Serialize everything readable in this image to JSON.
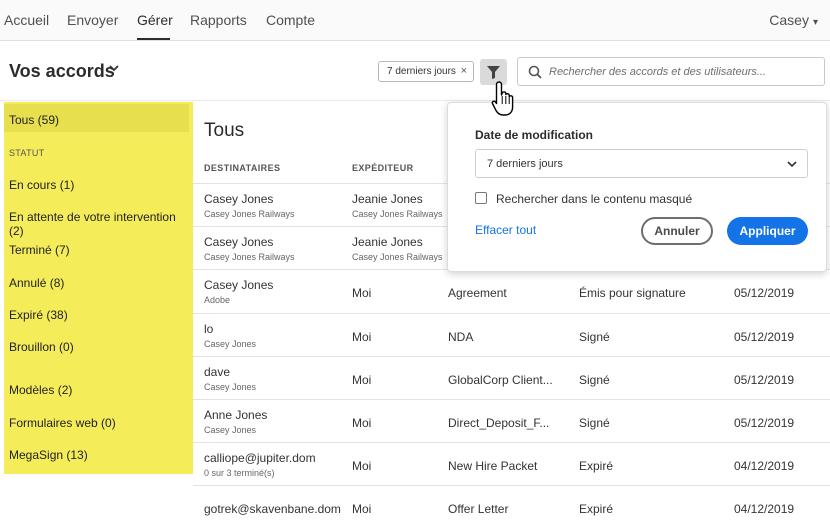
{
  "topnav": {
    "items": [
      {
        "label": "Accueil"
      },
      {
        "label": "Envoyer"
      },
      {
        "label": "Gérer"
      },
      {
        "label": "Rapports"
      },
      {
        "label": "Compte"
      }
    ],
    "user": "Casey"
  },
  "header": {
    "title": "Vos accords",
    "filter_chip": "7 derniers jours",
    "search_placeholder": "Rechercher des accords et des utilisateurs..."
  },
  "sidebar": {
    "all": "Tous (59)",
    "status_heading": "STATUT",
    "status_items": [
      "En cours (1)",
      "En attente de votre intervention (2)",
      "Terminé (7)",
      "Annulé (8)",
      "Expiré (38)",
      "Brouillon (0)"
    ],
    "other_items": [
      "Modèles (2)",
      "Formulaires web (0)",
      "MegaSign (13)"
    ]
  },
  "list": {
    "title": "Tous",
    "col_recipients": "DESTINATAIRES",
    "col_sender": "EXPÉDITEUR",
    "rows": [
      {
        "recipient": "Casey Jones",
        "recipient_sub": "Casey Jones Railways",
        "sender": "Jeanie Jones",
        "sender_sub": "Casey Jones Railways",
        "name": "",
        "status": "",
        "date": ""
      },
      {
        "recipient": "Casey Jones",
        "recipient_sub": "Casey Jones Railways",
        "sender": "Jeanie Jones",
        "sender_sub": "Casey Jones Railways",
        "name": "",
        "status": "",
        "date": ""
      },
      {
        "recipient": "Casey Jones",
        "recipient_sub": "Adobe",
        "sender": "Moi",
        "sender_sub": "",
        "name": "Agreement",
        "status": "Émis pour signature",
        "date": "05/12/2019"
      },
      {
        "recipient": "lo",
        "recipient_sub": "Casey Jones",
        "sender": "Moi",
        "sender_sub": "",
        "name": "NDA",
        "status": "Signé",
        "date": "05/12/2019"
      },
      {
        "recipient": "dave",
        "recipient_sub": "Casey Jones",
        "sender": "Moi",
        "sender_sub": "",
        "name": "GlobalCorp Client...",
        "status": "Signé",
        "date": "05/12/2019"
      },
      {
        "recipient": "Anne Jones",
        "recipient_sub": "Casey Jones",
        "sender": "Moi",
        "sender_sub": "",
        "name": "Direct_Deposit_F...",
        "status": "Signé",
        "date": "05/12/2019"
      },
      {
        "recipient": "calliope@jupiter.dom",
        "recipient_sub": "0 sur 3 terminé(s)",
        "sender": "Moi",
        "sender_sub": "",
        "name": "New Hire Packet",
        "status": "Expiré",
        "date": "04/12/2019"
      },
      {
        "recipient": "gotrek@skavenbane.dom",
        "recipient_sub": "",
        "sender": "Moi",
        "sender_sub": "",
        "name": "Offer Letter",
        "status": "Expiré",
        "date": "04/12/2019"
      }
    ]
  },
  "filter_popover": {
    "label": "Date de modification",
    "selected": "7 derniers jours",
    "checkbox_label": "Rechercher dans le contenu masqué",
    "checkbox_checked": false,
    "clear": "Effacer tout",
    "cancel": "Annuler",
    "apply": "Appliquer"
  },
  "colors": {
    "accent": "#1473e6",
    "highlight": "#f4ec58"
  }
}
